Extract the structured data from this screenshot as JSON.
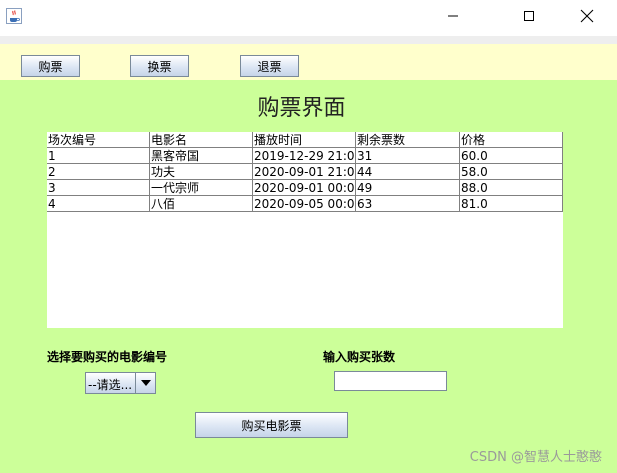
{
  "window": {
    "minimize_icon": "minimize-icon",
    "maximize_icon": "maximize-icon",
    "close_icon": "close-icon",
    "app_icon": "java-app-icon"
  },
  "toolbar": {
    "buy_label": "购票",
    "change_label": "换票",
    "refund_label": "退票"
  },
  "main": {
    "title": "购票界面",
    "table": {
      "columns": [
        "场次编号",
        "电影名",
        "播放时间",
        "剩余票数",
        "价格"
      ],
      "rows": [
        [
          "1",
          "黑客帝国",
          "2019-12-29 21:0...",
          "31",
          "60.0"
        ],
        [
          "2",
          "功夫",
          "2020-09-01 21:0...",
          "44",
          "58.0"
        ],
        [
          "3",
          "一代宗师",
          "2020-09-01 00:0...",
          "49",
          "88.0"
        ],
        [
          "4",
          "八佰",
          "2020-09-05 00:0...",
          "63",
          "81.0"
        ]
      ]
    },
    "choose_label": "选择要购买的电影编号",
    "combo_selected": "--请选...",
    "count_label": "输入购买张数",
    "count_value": "",
    "buy_button_label": "购买电影票",
    "watermark": "CSDN @智慧人士憨憨"
  },
  "colors": {
    "toolbar_bg": "#ffffcc",
    "panel_bg": "#ccff99"
  }
}
